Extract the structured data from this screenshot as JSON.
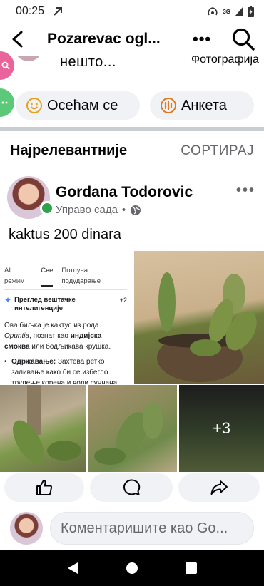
{
  "status_bar": {
    "time": "00:25",
    "network": "3G"
  },
  "header": {
    "title": "Pozarevac ogl..."
  },
  "composer": {
    "placeholder": "нешто...",
    "photo_label": "Фотографија"
  },
  "chips": [
    {
      "label": "Осећам се"
    },
    {
      "label": "Анкета"
    }
  ],
  "sort_bar": {
    "relevant_label": "Најрелевантније",
    "sort_label": "СОРТИРАЈ"
  },
  "post": {
    "author": "Gordana Todorovic",
    "time": "Управо сада",
    "text": "kaktus 200 dinara",
    "ai_image": {
      "tabs": [
        "AI режим",
        "Све",
        "Потпуна подударање"
      ],
      "overview_title": "Преглед вештачке интелигенције",
      "badge": "+2",
      "body_1": "Ова биљка је кактус из рода ",
      "body_genus": "Opuntia",
      "body_2": ", познат као ",
      "body_bold": "индијска смоква",
      "body_3": " или бодљикава крушка.",
      "bullet_label": "Одржавање:",
      "bullet_text": " Захтева ретко заливање како би се избегло трулење корена и воли сунчана места"
    },
    "more_photos": "+3"
  },
  "comment": {
    "placeholder": "Коментаришите као Go..."
  }
}
